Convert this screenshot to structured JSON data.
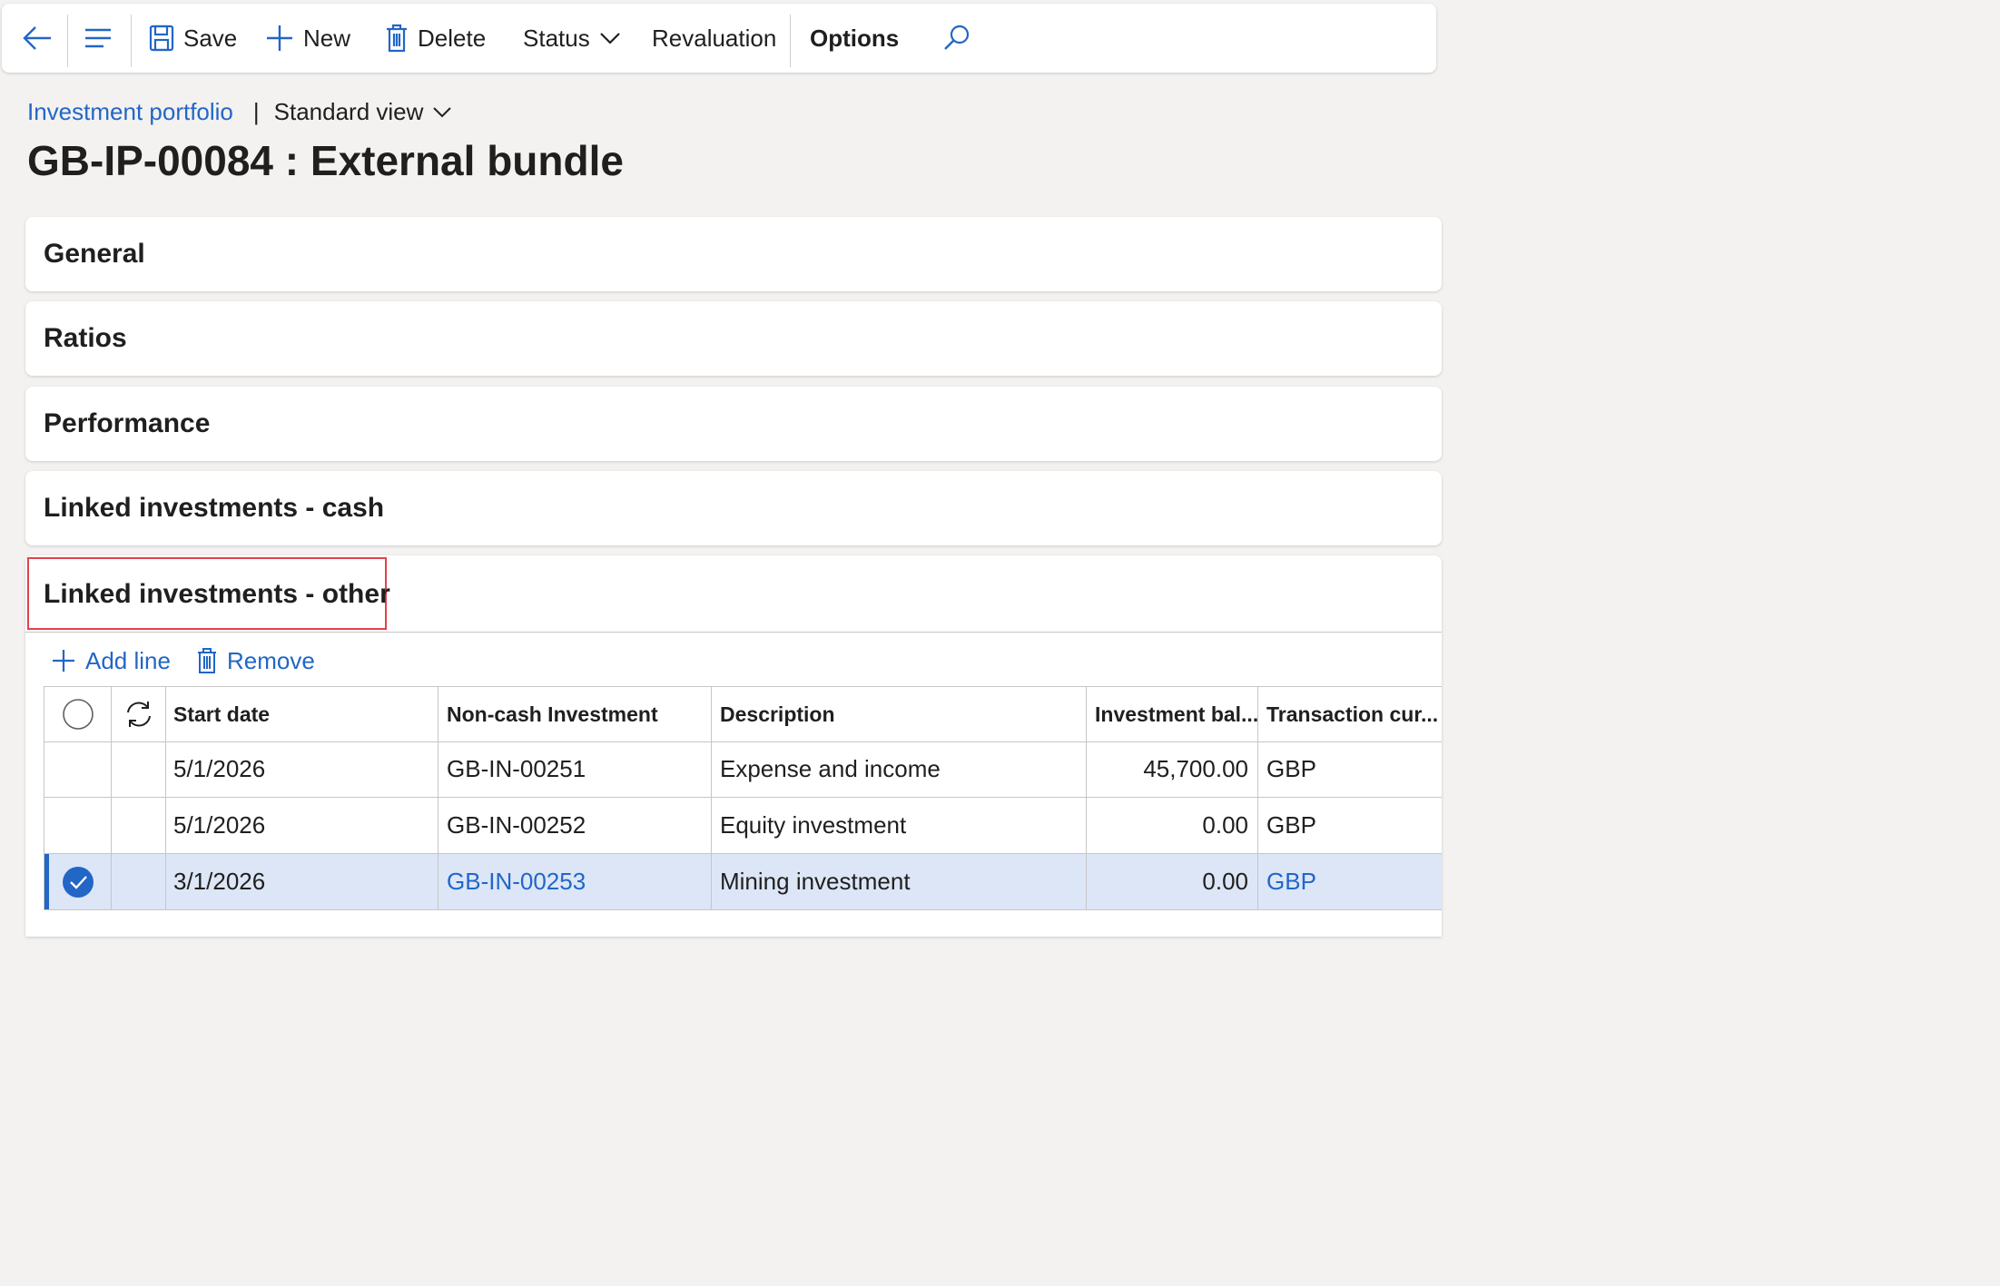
{
  "toolbar": {
    "save_label": "Save",
    "new_label": "New",
    "delete_label": "Delete",
    "status_label": "Status",
    "revaluation_label": "Revaluation",
    "options_label": "Options"
  },
  "breadcrumb": {
    "link": "Investment portfolio",
    "separator": "|",
    "view": "Standard view"
  },
  "page_title": "GB-IP-00084 : External bundle",
  "sections": [
    "General",
    "Ratios",
    "Performance",
    "Linked investments - cash"
  ],
  "open_section": {
    "title": "Linked investments - other",
    "add_line_label": "Add line",
    "remove_label": "Remove",
    "columns": [
      "Start date",
      "Non-cash Investment",
      "Description",
      "Investment bal...",
      "Transaction cur..."
    ],
    "rows": [
      {
        "start_date": "5/1/2026",
        "investment": "GB-IN-00251",
        "description": "Expense and income",
        "balance": "45,700.00",
        "currency": "GBP",
        "selected": false
      },
      {
        "start_date": "5/1/2026",
        "investment": "GB-IN-00252",
        "description": "Equity investment",
        "balance": "0.00",
        "currency": "GBP",
        "selected": false
      },
      {
        "start_date": "3/1/2026",
        "investment": "GB-IN-00253",
        "description": "Mining investment",
        "balance": "0.00",
        "currency": "GBP",
        "selected": true
      }
    ]
  },
  "colors": {
    "accent": "#2266c6",
    "highlight_border": "#e0434b",
    "selected_row": "#dce6f7"
  }
}
